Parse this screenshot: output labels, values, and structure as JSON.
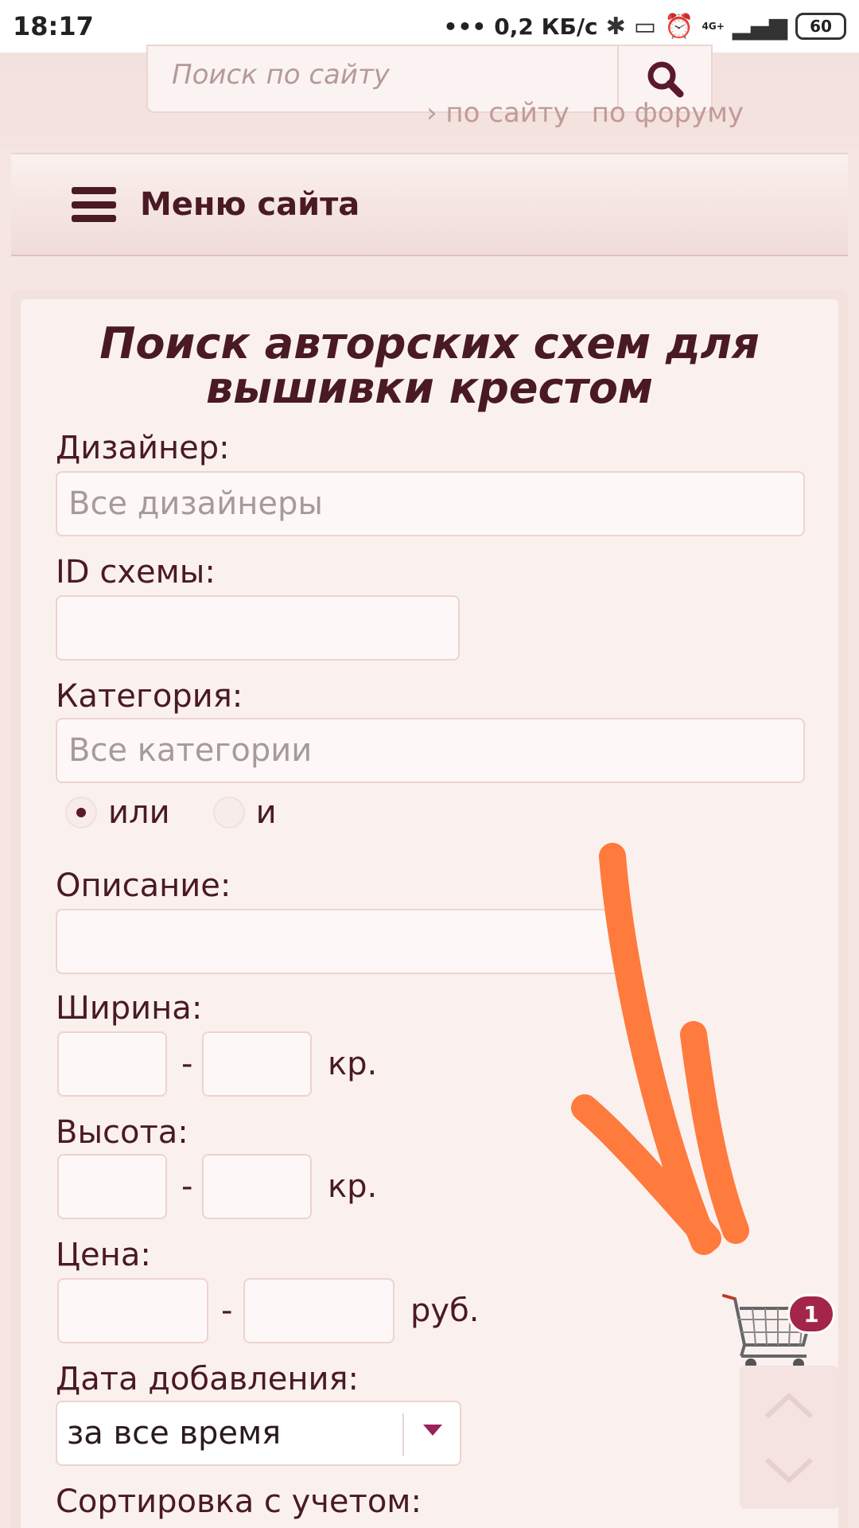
{
  "status_bar": {
    "time": "18:17",
    "speed": "0,2 КБ/с",
    "network": "4G+",
    "battery": "60"
  },
  "header": {
    "search_placeholder": "Поиск по сайту",
    "scope_site": "по сайту",
    "scope_forum": "по форуму"
  },
  "menu": {
    "label": "Меню сайта"
  },
  "form": {
    "title_line1": "Поиск авторских схем для",
    "title_line2": "вышивки крестом",
    "designer_label": "Дизайнер:",
    "designer_placeholder": "Все дизайнеры",
    "id_label": "ID схемы:",
    "category_label": "Категория:",
    "category_placeholder": "Все категории",
    "radio_or": "или",
    "radio_and": "и",
    "description_label": "Описание:",
    "width_label": "Ширина:",
    "height_label": "Высота:",
    "price_label": "Цена:",
    "dash": "-",
    "unit_stitches": "кр.",
    "unit_rub": "руб.",
    "date_label": "Дата добавления:",
    "date_value": "за все время",
    "sort_label": "Сортировка с учетом:"
  },
  "cart": {
    "count": "1"
  },
  "colors": {
    "accent": "#a3264a",
    "text": "#4a1a24",
    "annotation_arrow": "#ff7a3d"
  }
}
